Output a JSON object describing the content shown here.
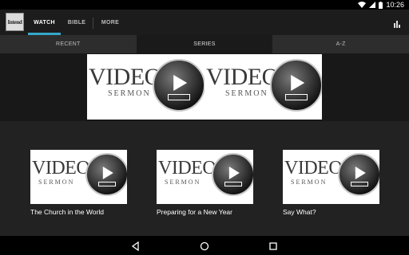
{
  "status": {
    "time": "10:26"
  },
  "app": {
    "logo_text": "Intend"
  },
  "tabs": [
    {
      "label": "WATCH",
      "active": true
    },
    {
      "label": "BIBLE",
      "active": false
    },
    {
      "label": "MORE",
      "active": false
    }
  ],
  "subtabs": [
    {
      "label": "RECENT",
      "active": false
    },
    {
      "label": "SERIES",
      "active": true
    },
    {
      "label": "A-Z",
      "active": false
    }
  ],
  "thumbnail": {
    "word": "VIDEO",
    "sub": "SERMON"
  },
  "cards": [
    {
      "title": "The Church in the World"
    },
    {
      "title": "Preparing for a New Year"
    },
    {
      "title": "Say What?"
    }
  ],
  "colors": {
    "accent": "#35a8c9",
    "appbar": "#1c1c1c"
  },
  "icons": [
    "wifi-icon",
    "signal-icon",
    "battery-icon",
    "bar-chart-icon",
    "back-icon",
    "home-icon",
    "recents-icon"
  ]
}
